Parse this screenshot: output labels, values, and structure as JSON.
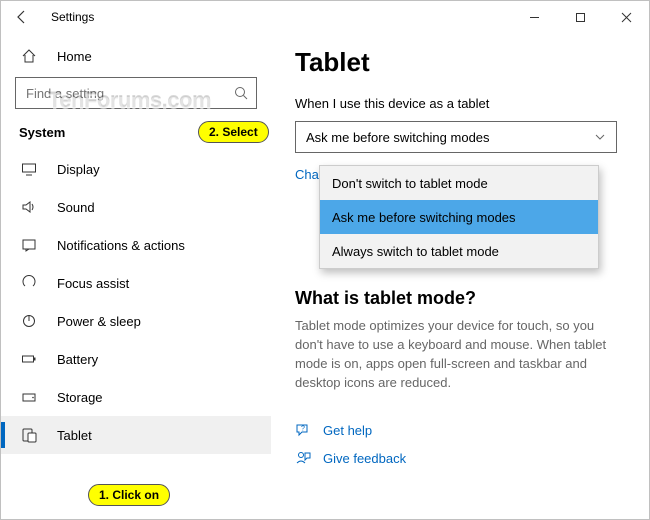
{
  "titlebar": {
    "title": "Settings"
  },
  "sidebar": {
    "home": "Home",
    "search_placeholder": "Find a setting",
    "section": "System",
    "items": [
      {
        "label": "Display"
      },
      {
        "label": "Sound"
      },
      {
        "label": "Notifications & actions"
      },
      {
        "label": "Focus assist"
      },
      {
        "label": "Power & sleep"
      },
      {
        "label": "Battery"
      },
      {
        "label": "Storage"
      },
      {
        "label": "Tablet"
      }
    ]
  },
  "content": {
    "title": "Tablet",
    "when_label": "When I use this device as a tablet",
    "select_value": "Ask me before switching modes",
    "dropdown": [
      "Don't switch to tablet mode",
      "Ask me before switching modes",
      "Always switch to tablet mode"
    ],
    "change_link_partial": "Chan",
    "sub_title": "What is tablet mode?",
    "paragraph": "Tablet mode optimizes your device for touch, so you don't have to use a keyboard and mouse. When tablet mode is on, apps open full-screen and taskbar and desktop icons are reduced.",
    "get_help": "Get help",
    "give_feedback": "Give feedback"
  },
  "callouts": {
    "c1": "1. Click on",
    "c2": "2. Select"
  },
  "watermark": "TenForums.com"
}
